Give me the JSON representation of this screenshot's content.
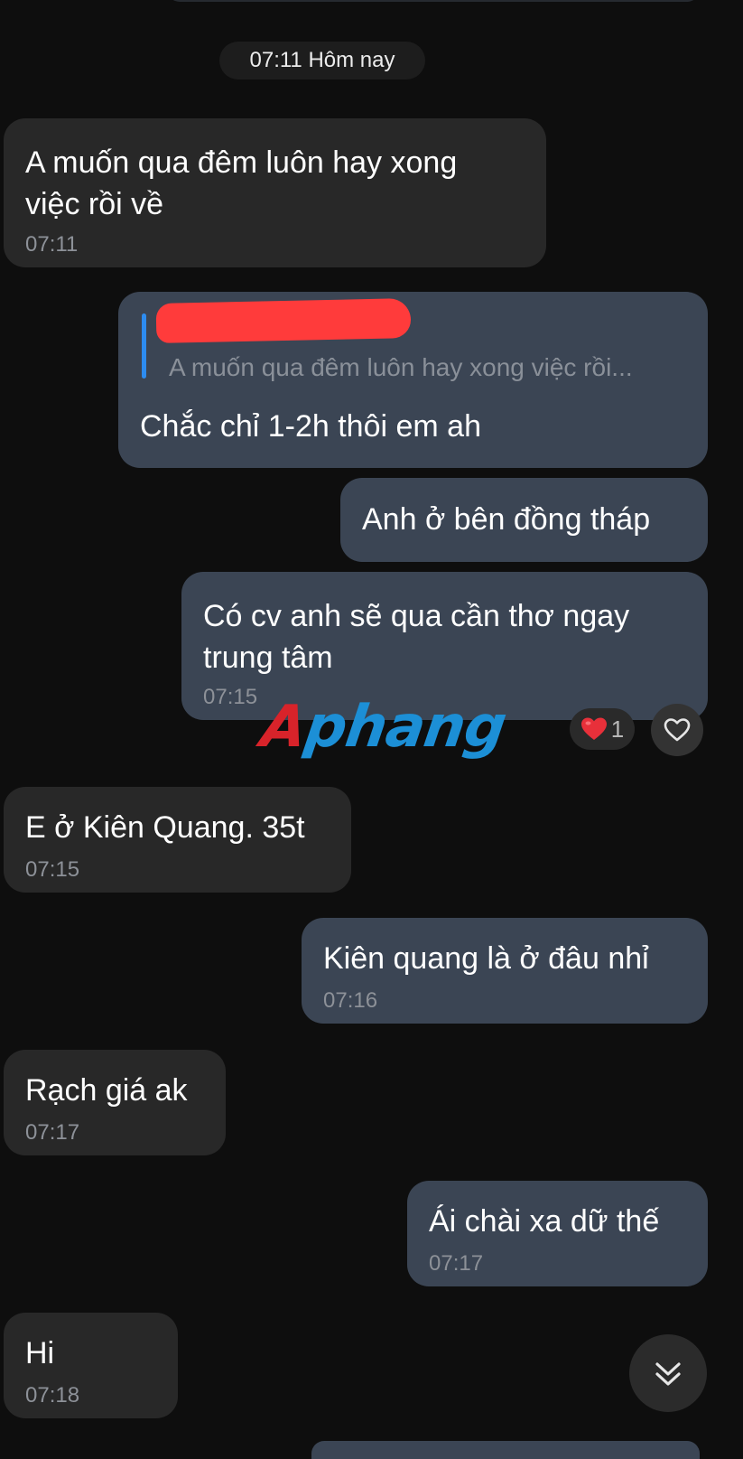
{
  "date_separator": "07:11 Hôm nay",
  "messages": [
    {
      "side": "incoming",
      "text": "A muốn qua đêm luôn hay xong\nviệc rồi về",
      "time": "07:11"
    },
    {
      "side": "outgoing",
      "quote": "A muốn qua đêm luôn hay xong việc rồi...",
      "text": "Chắc chỉ 1-2h thôi em ah"
    },
    {
      "side": "outgoing",
      "text": "Anh ở bên đồng tháp"
    },
    {
      "side": "outgoing",
      "text": "Có cv anh sẽ qua cần thơ ngay\ntrung tâm",
      "time": "07:15",
      "reaction": {
        "emoji": "❤️",
        "count": "1"
      }
    },
    {
      "side": "incoming",
      "text": "E ở Kiên Quang. 35t",
      "time": "07:15"
    },
    {
      "side": "outgoing",
      "text": "Kiên quang là ở đâu nhỉ",
      "time": "07:16"
    },
    {
      "side": "incoming",
      "text": "Rạch giá ak",
      "time": "07:17"
    },
    {
      "side": "outgoing",
      "text": "Ái chài xa dữ thế",
      "time": "07:17"
    },
    {
      "side": "incoming",
      "text": "Hi",
      "time": "07:18"
    }
  ],
  "watermark": {
    "first": "A",
    "rest": "phang"
  },
  "icons": {
    "react": "heart-outline-icon",
    "scroll": "double-chevron-down-icon"
  },
  "colors": {
    "background": "#0e0e0e",
    "incoming_bubble": "#282828",
    "outgoing_bubble": "#3b4554",
    "quote_bar": "#2d8cf0",
    "reaction_heart": "#e8303a"
  }
}
